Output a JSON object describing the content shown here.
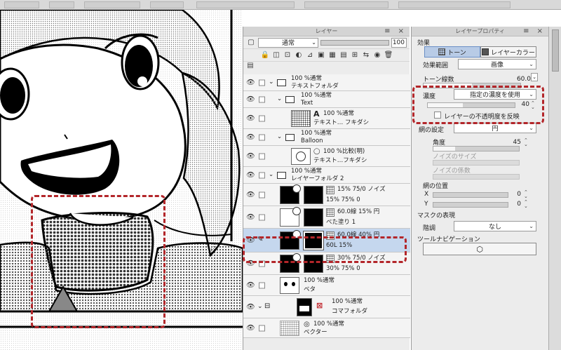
{
  "layer_panel": {
    "title": "レイヤー",
    "blend_mode": "通常",
    "opacity": "100",
    "layers": [
      {
        "name_line1": "100 %通常",
        "name_line2": "テキストフォルダ",
        "kind": "folder"
      },
      {
        "name_line1": "100 %通常",
        "name_line2": "Text",
        "kind": "folder"
      },
      {
        "name_line1": "100 %通常",
        "name_line2": "テキスト… フキダシ",
        "kind": "text-layer"
      },
      {
        "name_line1": "100 %通常",
        "name_line2": "Balloon",
        "kind": "folder"
      },
      {
        "name_line1": "100 %比較(明)",
        "name_line2": "テキスト…フキダシ",
        "kind": "balloon-layer"
      },
      {
        "name_line1": "100 %通常",
        "name_line2": "レイヤーフォルダ 2",
        "kind": "folder"
      },
      {
        "name_line1": "15% 75/0 ノイズ",
        "name_line2": "15% 75% 0",
        "kind": "tone-layer"
      },
      {
        "name_line1": "60.0線 15% 円",
        "name_line2": "べた塗り 1",
        "kind": "tone-layer"
      },
      {
        "name_line1": "60.0線 40% 円",
        "name_line2": "60L 15%",
        "kind": "tone-layer-selected"
      },
      {
        "name_line1": "30% 75/0 ノイズ",
        "name_line2": "30% 75% 0",
        "kind": "tone-layer"
      },
      {
        "name_line1": "100 %通常",
        "name_line2": "ベタ",
        "kind": "raster-layer"
      },
      {
        "name_line1": "100 %通常",
        "name_line2": "コマフォルダ",
        "kind": "frame-folder"
      },
      {
        "name_line1": "100 %通常",
        "name_line2": "ベクター",
        "kind": "vector-layer"
      }
    ]
  },
  "property_panel": {
    "title": "レイヤープロパティ",
    "effect_label": "効果",
    "tone_button": "トーン",
    "layer_color_button": "レイヤーカラー",
    "effect_range_label": "効果範囲",
    "effect_range_value": "画像",
    "tone_lines_label": "トーン線数",
    "tone_lines_value": "60.0",
    "density_label": "濃度",
    "density_mode": "指定の濃度を使用",
    "density_value": "40",
    "density_fraction": 0.4,
    "invert_opacity_label": "レイヤーの不透明度を反映",
    "dot_settings_label": "網の設定",
    "dot_shape": "円",
    "angle_label": "角度",
    "angle_value": "45",
    "noise_size_label": "ノイズのサイズ",
    "noise_factor_label": "ノイズの係数",
    "dot_position_label": "網の位置",
    "x_label": "X",
    "x_value": "0",
    "y_label": "Y",
    "y_value": "0",
    "mask_label": "マスクの表現",
    "gradation_label": "階調",
    "gradation_value": "なし",
    "tool_navigation_label": "ツールナビゲーション"
  }
}
